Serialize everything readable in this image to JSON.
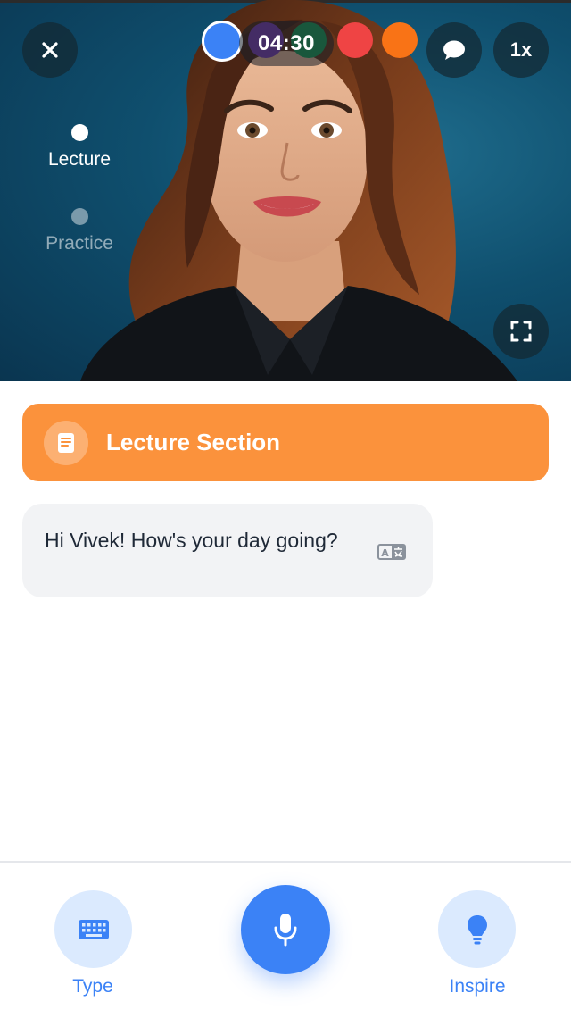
{
  "header": {
    "timer": "04:30",
    "speed_label": "1x",
    "color_dots": [
      "#3b82f6",
      "#7e3fb0",
      "#1f9d55",
      "#ef4444",
      "#f97316"
    ]
  },
  "stages": [
    {
      "label": "Lecture",
      "active": true
    },
    {
      "label": "Practice",
      "active": false
    }
  ],
  "section": {
    "title": "Lecture Section",
    "color": "#fb923c"
  },
  "messages": [
    {
      "text": "Hi Vivek! How's your day going?"
    }
  ],
  "bottom": {
    "type_label": "Type",
    "inspire_label": "Inspire",
    "accent": "#3b82f6"
  },
  "icons": {
    "close": "close-icon",
    "chat": "chat-icon",
    "fullscreen": "fullscreen-icon",
    "book": "book-icon",
    "translate": "translate-icon",
    "keyboard": "keyboard-icon",
    "mic": "microphone-icon",
    "bulb": "lightbulb-icon"
  }
}
